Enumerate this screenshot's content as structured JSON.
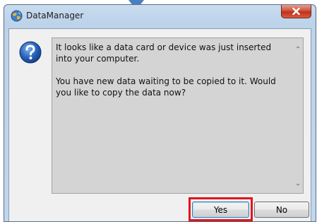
{
  "window": {
    "title": "DataManager",
    "close_icon": "close-icon",
    "app_icon": "globe-app-icon"
  },
  "dialog": {
    "icon": "question-icon",
    "message_line_1": "It looks like a data card or device was just inserted into your computer.",
    "message_line_2": "You have new data waiting to be copied to it.  Would you like to copy the data now?"
  },
  "buttons": {
    "yes_label": "Yes",
    "no_label": "No"
  },
  "colors": {
    "highlight": "#e0141e",
    "arrow": "#4a7fc1"
  }
}
